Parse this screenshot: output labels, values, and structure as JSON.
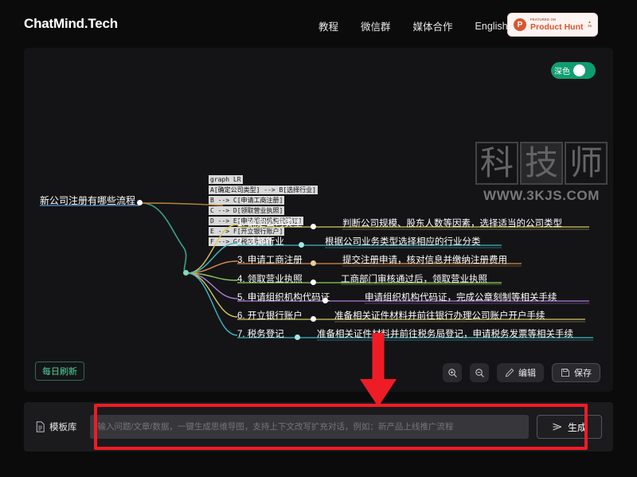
{
  "header": {
    "logo": "ChatMind.Tech",
    "nav": [
      {
        "label": "教程"
      },
      {
        "label": "微信群"
      },
      {
        "label": "媒体合作"
      },
      {
        "label": "English"
      }
    ],
    "product_hunt": {
      "top_label": "FEATURED ON",
      "main_label": "Product Hunt",
      "mark": "P",
      "caret": "▲",
      "count": "35"
    }
  },
  "canvas": {
    "dark_toggle": {
      "label": "深色",
      "on": true
    },
    "watermark": {
      "chars": [
        "科",
        "技",
        "师"
      ],
      "url": "WWW.3KJS.COM"
    },
    "code_block": [
      "graph LR",
      "A[确定公司类型] --> B[选择行业]",
      "B --> C[申请工商注册]",
      "C --> D[领取营业执照]",
      "D --> E[申请组织机构代码证]",
      "E --> F[开立银行账户]",
      "F --> G[税务登记]"
    ],
    "root_node": "新公司注册有哪些流程",
    "branches": [
      {
        "label": "1. 确定公司类型",
        "detail": "判断公司规模、股东人数等因素，选择适当的公司类型",
        "color": "#d8c75a"
      },
      {
        "label": "2. 选择行业",
        "detail": "根据公司业务类型选择相应的行业分类",
        "color": "#3fb6c4"
      },
      {
        "label": "3. 申请工商注册",
        "detail": "提交注册申请，核对信息并缴纳注册费用",
        "color": "#d98a4a"
      },
      {
        "label": "4. 领取营业执照",
        "detail": "工商部门审核通过后，领取营业执照",
        "color": "#8fce5a"
      },
      {
        "label": "5. 申请组织机构代码证",
        "detail": "申请组织机构代码证，完成公章刻制等相关手续",
        "color": "#b07ad6"
      },
      {
        "label": "6. 开立银行账户",
        "detail": "准备相关证件材料并前往银行办理公司账户开户手续",
        "color": "#d8c75a"
      },
      {
        "label": "7. 税务登记",
        "detail": "准备相关证件材料并前往税务局登记，申请税务发票等相关手续",
        "color": "#3fb6c4"
      }
    ],
    "refresh_button": "每日刷新",
    "tools": {
      "zoom_in": "zoom-in-icon",
      "zoom_out": "zoom-out-icon",
      "edit": "编辑",
      "save": "保存"
    }
  },
  "bottom_bar": {
    "template_button": "模板库",
    "input_placeholder": "输入问题/文章/数据，一键生成思维导图，支持上下文改写扩充对话，例如：新产品上线推广流程",
    "input_value": "",
    "generate_button": "生成"
  },
  "annotation": {
    "accent_color": "#ee1c25"
  }
}
